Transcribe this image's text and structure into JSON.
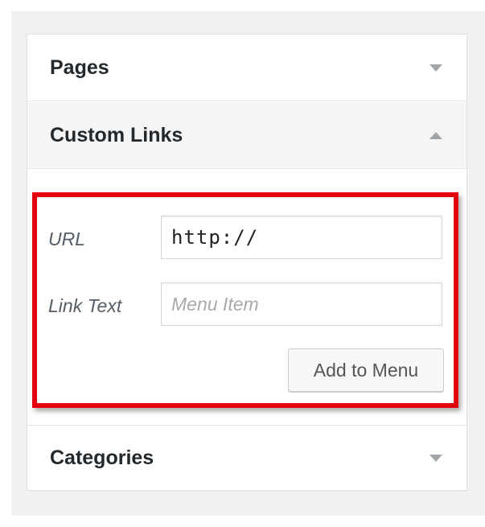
{
  "accordion": {
    "sections": [
      {
        "title": "Pages",
        "state": "collapsed",
        "arrow_icon": "chevron-down-icon"
      },
      {
        "title": "Custom Links",
        "state": "expanded",
        "arrow_icon": "chevron-up-icon"
      },
      {
        "title": "Categories",
        "state": "collapsed",
        "arrow_icon": "chevron-down-icon"
      }
    ]
  },
  "custom_links": {
    "url_label": "URL",
    "url_value": "http://",
    "link_text_label": "Link Text",
    "link_text_placeholder": "Menu Item",
    "add_button_label": "Add to Menu"
  },
  "colors": {
    "highlight_border": "#e3000f",
    "header_text": "#23282d",
    "arrow": "#a0a5aa",
    "expanded_header_bg": "#f5f5f5"
  }
}
